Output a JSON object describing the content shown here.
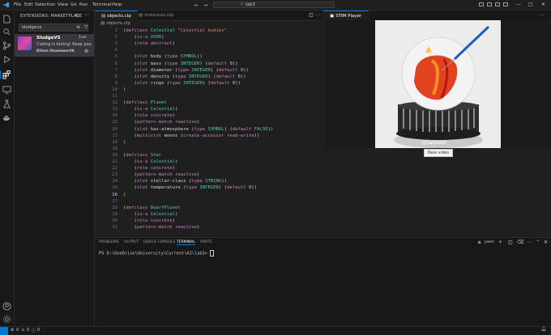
{
  "titlebar": {
    "menus": [
      "File",
      "Edit",
      "Selection",
      "View",
      "Go",
      "Run",
      "Terminal",
      "Help"
    ],
    "search": "lab3"
  },
  "sidebar": {
    "title": "EXTENSIONS: MARKETPLACE",
    "search_value": "sludgevs",
    "extension": {
      "name": "SludgeVS",
      "description": "Coding is boring! Keep your ...",
      "author": "Ethan Houseworth",
      "downloads": "1ew"
    }
  },
  "editor": {
    "tabs": [
      "objects.clp",
      "instances.clp"
    ],
    "breadcrumb": "objects.clp",
    "lines": [
      {
        "n": "1",
        "html": "<span class='pn'>(</span><span class='kw'>defclass</span> <span class='ty'>Celestial</span> <span class='st'>\"Celestial bodies\"</span>"
      },
      {
        "n": "2",
        "html": "    <span class='bl'>(</span><span class='kw'>is-a</span> <span class='ty'>USER</span><span class='bl'>)</span>"
      },
      {
        "n": "3",
        "html": "    <span class='bl'>(</span><span class='kw'>role</span> <span class='kw'>abstract</span><span class='bl'>)</span>"
      },
      {
        "n": "4",
        "html": ""
      },
      {
        "n": "5",
        "html": "    <span class='bl'>(</span><span class='kw'>slot</span> body <span class='pl'>(</span><span class='kw'>type</span> <span class='ty'>SYMBOL</span><span class='pl'>)</span><span class='bl'>)</span>"
      },
      {
        "n": "6",
        "html": "    <span class='bl'>(</span><span class='kw'>slot</span> mass <span class='pl'>(</span><span class='kw'>type</span> <span class='ty'>INTEGER</span><span class='pl'>)</span> <span class='pl'>(</span><span class='kw'>default</span> <span class='nm'>0</span><span class='pl'>)</span><span class='bl'>)</span>"
      },
      {
        "n": "7",
        "html": "    <span class='bl'>(</span><span class='kw'>slot</span> diameter <span class='pl'>(</span><span class='kw'>type</span> <span class='ty'>INTEGER</span><span class='pl'>)</span> <span class='pl'>(</span><span class='kw'>default</span> <span class='nm'>0</span><span class='pl'>)</span><span class='bl'>)</span>"
      },
      {
        "n": "8",
        "html": "    <span class='bl'>(</span><span class='kw'>slot</span> density <span class='pl'>(</span><span class='kw'>type</span> <span class='ty'>INTEGER</span><span class='pl'>)</span> <span class='pl'>(</span><span class='kw'>default</span> <span class='nm'>0</span><span class='pl'>)</span><span class='bl'>)</span>"
      },
      {
        "n": "9",
        "html": "    <span class='bl'>(</span><span class='kw'>slot</span> rings <span class='pl'>(</span><span class='kw'>type</span> <span class='ty'>INTEGER</span><span class='pl'>)</span> <span class='pl'>(</span><span class='kw'>default</span> <span class='nm'>0</span><span class='pl'>)</span><span class='bl'>)</span>"
      },
      {
        "n": "10",
        "html": "<span class='pn'>)</span>"
      },
      {
        "n": "11",
        "html": ""
      },
      {
        "n": "12",
        "html": "<span class='pn'>(</span><span class='kw'>defclass</span> <span class='ty'>Planet</span>"
      },
      {
        "n": "13",
        "html": "    <span class='bl'>(</span><span class='kw'>is-a</span> <span class='ty'>Celestial</span><span class='bl'>)</span>"
      },
      {
        "n": "14",
        "html": "    <span class='bl'>(</span><span class='kw'>role</span> <span class='kw'>concrete</span><span class='bl'>)</span>"
      },
      {
        "n": "15",
        "html": "    <span class='bl'>(</span><span class='kw'>pattern-match</span> <span class='kw'>reactive</span><span class='bl'>)</span>"
      },
      {
        "n": "16",
        "html": "    <span class='bl'>(</span><span class='kw'>slot</span> has-atmosphere <span class='pl'>(</span><span class='kw'>type</span> <span class='ty'>SYMBOL</span><span class='pl'>)</span> <span class='pl'>(</span><span class='kw'>default</span> <span class='ty'>FALSE</span><span class='pl'>)</span><span class='bl'>)</span>"
      },
      {
        "n": "17",
        "html": "    <span class='bl'>(</span><span class='kw'>multislot</span> moons <span class='pl'>(</span><span class='kw'>create-accessor</span> <span class='kw'>read-write</span><span class='pl'>)</span><span class='bl'>)</span>"
      },
      {
        "n": "18",
        "html": "<span class='pn'>)</span>"
      },
      {
        "n": "19",
        "html": ""
      },
      {
        "n": "20",
        "html": "<span class='pn'>(</span><span class='kw'>defclass</span> <span class='ty'>Star</span>"
      },
      {
        "n": "21",
        "html": "    <span class='bl'>(</span><span class='kw'>is-a</span> <span class='ty'>Celestial</span><span class='bl'>)</span>"
      },
      {
        "n": "22",
        "html": "    <span class='bl'>(</span><span class='kw'>role</span> <span class='kw'>concrete</span><span class='bl'>)</span>"
      },
      {
        "n": "23",
        "html": "    <span class='bl'>(</span><span class='kw'>pattern-match</span> <span class='kw'>reactive</span><span class='bl'>)</span>"
      },
      {
        "n": "24",
        "html": "    <span class='bl'>(</span><span class='kw'>slot</span> stellar-class <span class='pl'>(</span><span class='kw'>type</span> <span class='ty'>STRING</span><span class='pl'>)</span><span class='bl'>)</span>"
      },
      {
        "n": "25",
        "html": "    <span class='bl'>(</span><span class='kw'>slot</span> temperature <span class='pl'>(</span><span class='kw'>type</span> <span class='ty'>INTEGER</span><span class='pl'>)</span> <span class='pl'>(</span><span class='kw'>default</span> <span class='nm'>0</span><span class='pl'>)</span><span class='bl'>)</span>"
      },
      {
        "n": "26",
        "html": "<span class='pn'>)</span>"
      },
      {
        "n": "27",
        "html": ""
      },
      {
        "n": "28",
        "html": "<span class='pn'>(</span><span class='kw'>defclass</span> <span class='ty'>DwarfPlanet</span>"
      },
      {
        "n": "29",
        "html": "    <span class='bl'>(</span><span class='kw'>is-a</span> <span class='ty'>Celestial</span><span class='bl'>)</span>"
      },
      {
        "n": "30",
        "html": "    <span class='bl'>(</span><span class='kw'>role</span> <span class='kw'>concrete</span><span class='bl'>)</span>"
      },
      {
        "n": "31",
        "html": "    <span class='bl'>(</span><span class='kw'>pattern-match</span> <span class='kw'>reactive</span><span class='bl'>)</span>"
      }
    ]
  },
  "player": {
    "tab": "STIM Player",
    "watermark": "@SatisVid",
    "tooltip": "New video"
  },
  "panel": {
    "tabs": [
      "PROBLEMS",
      "OUTPUT",
      "DEBUG CONSOLE",
      "TERMINAL",
      "PORTS"
    ],
    "active_tab": "TERMINAL",
    "shell": "pwsh",
    "prompt": "PS D:\\OneDrive\\University\\Current\\AI\\lab3>"
  },
  "status": {
    "errors": "0",
    "warnings": "0",
    "info": "0"
  }
}
